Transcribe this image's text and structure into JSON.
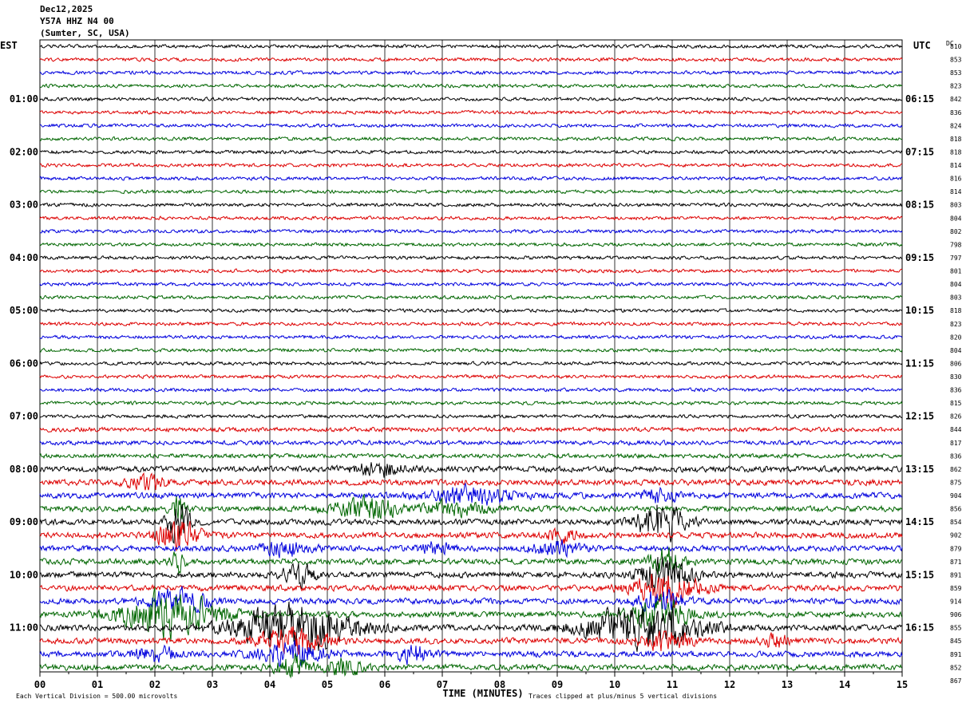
{
  "header": {
    "date": "Dec12,2025",
    "station": "Y57A HHZ N4 00",
    "location": "(Sumter, SC, USA)"
  },
  "chart_data": {
    "type": "line",
    "title": "Dec12,2025",
    "subtitle": "Y57A HHZ N4 00",
    "xlabel": "TIME (MINUTES)",
    "x_ticks": [
      "00",
      "01",
      "02",
      "03",
      "04",
      "05",
      "06",
      "07",
      "08",
      "09",
      "10",
      "11",
      "12",
      "13",
      "14",
      "15"
    ],
    "xlim": [
      0,
      15
    ],
    "left_axis_label": "EST",
    "right_axis_label": "UTC",
    "dc_label": "DC",
    "left_hour_labels": [
      "01:00",
      "02:00",
      "03:00",
      "04:00",
      "05:00",
      "06:00",
      "07:00",
      "08:00",
      "09:00",
      "10:00",
      "11:00"
    ],
    "right_hour_labels": [
      "06:15",
      "07:15",
      "08:15",
      "09:15",
      "10:15",
      "11:15",
      "12:15",
      "13:15",
      "14:15",
      "15:15",
      "16:15"
    ],
    "trace_colors": [
      "#000000",
      "#dd0000",
      "#0000dd",
      "#006600"
    ],
    "dc_offsets": [
      810,
      853,
      853,
      823,
      842,
      836,
      824,
      818,
      818,
      814,
      816,
      814,
      803,
      804,
      802,
      798,
      797,
      801,
      804,
      803,
      818,
      823,
      820,
      804,
      806,
      830,
      836,
      815,
      826,
      844,
      817,
      836,
      862,
      875,
      904,
      856,
      854,
      902,
      879,
      871,
      891,
      859,
      914,
      906,
      855,
      845,
      891,
      852,
      867
    ],
    "traces_count": 48,
    "footer_left": "Each Vertical Division =  500.00 microvolts",
    "footer_right": "Traces clipped at plus/minus 5 vertical divisions",
    "grid": true
  }
}
